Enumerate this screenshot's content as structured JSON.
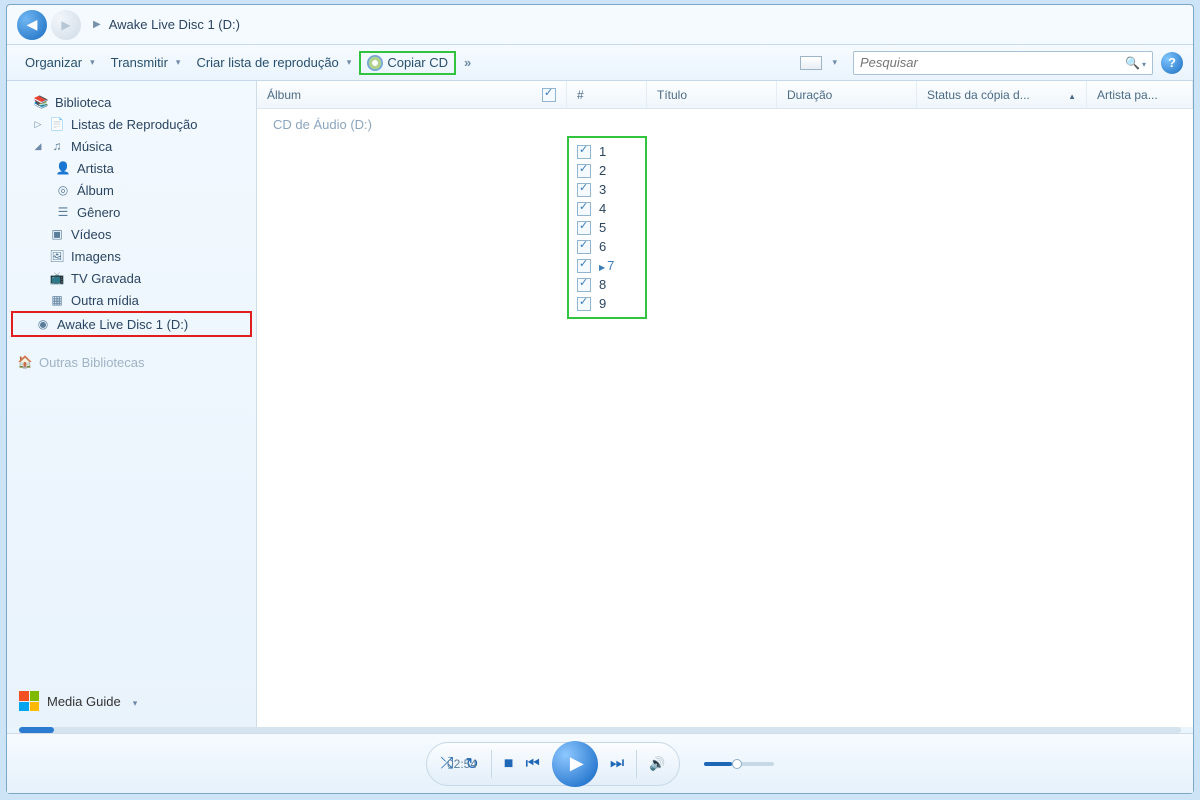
{
  "nav": {
    "breadcrumb": "Awake Live Disc 1 (D:)"
  },
  "toolbar": {
    "organize": "Organizar",
    "stream": "Transmitir",
    "create_playlist": "Criar lista de reprodução",
    "rip_cd": "Copiar CD",
    "search_placeholder": "Pesquisar"
  },
  "sidebar": {
    "library": "Biblioteca",
    "playlists": "Listas de Reprodução",
    "music": "Música",
    "artist": "Artista",
    "album": "Álbum",
    "genre": "Gênero",
    "videos": "Vídeos",
    "images": "Imagens",
    "recorded_tv": "TV Gravada",
    "other_media": "Outra mídia",
    "disc": "Awake Live Disc 1 (D:)",
    "other_libraries": "Outras Bibliotecas",
    "media_guide": "Media Guide"
  },
  "columns": {
    "album": "Álbum",
    "num": "#",
    "title": "Título",
    "duration": "Duração",
    "rip_status": "Status da cópia d...",
    "artist": "Artista pa..."
  },
  "group": {
    "label": "CD de Áudio (D:)"
  },
  "tracks": [
    {
      "n": "1",
      "checked": true
    },
    {
      "n": "2",
      "checked": true
    },
    {
      "n": "3",
      "checked": true
    },
    {
      "n": "4",
      "checked": true
    },
    {
      "n": "5",
      "checked": true
    },
    {
      "n": "6",
      "checked": true
    },
    {
      "n": "7",
      "checked": true,
      "playing": true
    },
    {
      "n": "8",
      "checked": true
    },
    {
      "n": "9",
      "checked": true
    }
  ],
  "player": {
    "elapsed": "02:54"
  },
  "annotations": {
    "green_boxes": [
      "rip-cd-button",
      "track-checkbox-column"
    ],
    "red_box": "sidebar-disc-item"
  }
}
